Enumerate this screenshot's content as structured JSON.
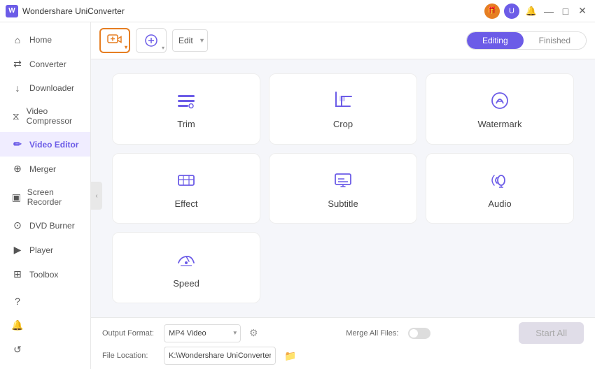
{
  "app": {
    "title": "Wondershare UniConverter",
    "logo_letter": "W"
  },
  "titlebar": {
    "icons": {
      "gift": "🎁",
      "user": "U",
      "bell": "🔔",
      "minimize": "—",
      "maximize": "□",
      "close": "✕"
    }
  },
  "sidebar": {
    "items": [
      {
        "id": "home",
        "label": "Home",
        "icon": "⌂"
      },
      {
        "id": "converter",
        "label": "Converter",
        "icon": "⇄"
      },
      {
        "id": "downloader",
        "label": "Downloader",
        "icon": "↓"
      },
      {
        "id": "video-compressor",
        "label": "Video Compressor",
        "icon": "⧖"
      },
      {
        "id": "video-editor",
        "label": "Video Editor",
        "icon": "✏",
        "active": true
      },
      {
        "id": "merger",
        "label": "Merger",
        "icon": "⊕"
      },
      {
        "id": "screen-recorder",
        "label": "Screen Recorder",
        "icon": "▣"
      },
      {
        "id": "dvd-burner",
        "label": "DVD Burner",
        "icon": "⊙"
      },
      {
        "id": "player",
        "label": "Player",
        "icon": "▶"
      },
      {
        "id": "toolbox",
        "label": "Toolbox",
        "icon": "⊞"
      }
    ],
    "footer": [
      {
        "id": "help",
        "icon": "?"
      },
      {
        "id": "notifications",
        "icon": "🔔"
      },
      {
        "id": "refresh",
        "icon": "↺"
      }
    ],
    "collapse_label": "‹"
  },
  "toolbar": {
    "add_video_label": "add-video",
    "add_extra_label": "add-extra",
    "edit_options": [
      "Edit"
    ],
    "edit_default": "Edit",
    "tabs": [
      {
        "id": "editing",
        "label": "Editing",
        "active": true
      },
      {
        "id": "finished",
        "label": "Finished",
        "active": false
      }
    ]
  },
  "tools": [
    {
      "id": "trim",
      "label": "Trim"
    },
    {
      "id": "crop",
      "label": "Crop"
    },
    {
      "id": "watermark",
      "label": "Watermark"
    },
    {
      "id": "effect",
      "label": "Effect"
    },
    {
      "id": "subtitle",
      "label": "Subtitle"
    },
    {
      "id": "audio",
      "label": "Audio"
    },
    {
      "id": "speed",
      "label": "Speed"
    },
    {
      "id": "empty1",
      "label": "",
      "empty": true
    },
    {
      "id": "empty2",
      "label": "",
      "empty": true
    }
  ],
  "bottom": {
    "output_format_label": "Output Format:",
    "output_format_value": "MP4 Video",
    "quality_icon": "⚙",
    "merge_label": "Merge All Files:",
    "file_location_label": "File Location:",
    "file_location_value": "K:\\Wondershare UniConverter",
    "start_label": "Start All"
  }
}
